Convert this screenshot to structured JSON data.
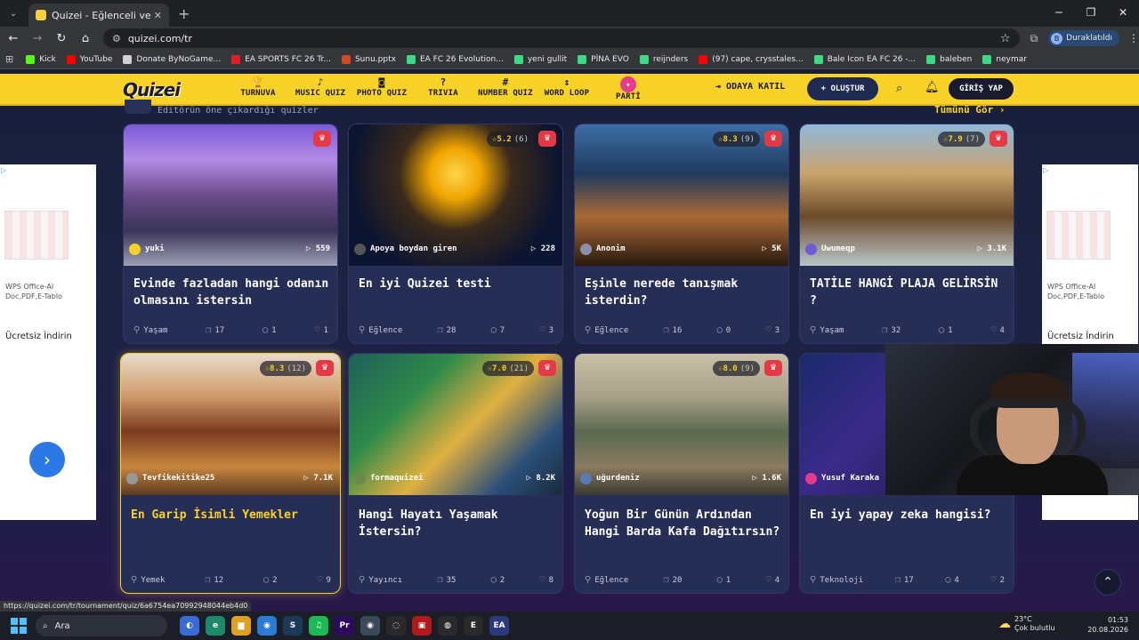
{
  "browser": {
    "tab_title": "Quizei - Eğlenceli ve etkileşimli",
    "url": "quizei.com/tr",
    "profile_initial": "B",
    "profile_label": "Duraklatıldı",
    "status_url": "https://quizei.com/tr/tournament/quiz/6a6754ea70992948044eb4d0",
    "bookmarks": [
      {
        "label": "Kick",
        "color": "#53fc18"
      },
      {
        "label": "YouTube",
        "color": "#ff0000"
      },
      {
        "label": "Donate ByNoGame...",
        "color": "#d0d0d0"
      },
      {
        "label": "EA SPORTS FC 26 Tr...",
        "color": "#e02020"
      },
      {
        "label": "Sunu.pptx",
        "color": "#d24726"
      },
      {
        "label": "EA FC 26 Evolution...",
        "color": "#3ddc84"
      },
      {
        "label": "yeni gullit",
        "color": "#3ddc84"
      },
      {
        "label": "PİNA EVO",
        "color": "#3ddc84"
      },
      {
        "label": "reijnders",
        "color": "#3ddc84"
      },
      {
        "label": "(97) cape, crysstales...",
        "color": "#ff0000"
      },
      {
        "label": "Bale Icon EA FC 26 -...",
        "color": "#3ddc84"
      },
      {
        "label": "baleben",
        "color": "#3ddc84"
      },
      {
        "label": "neymar",
        "color": "#3ddc84"
      }
    ]
  },
  "site": {
    "logo": "Quizei",
    "nav": [
      {
        "label": "TURNUVA",
        "icon": "🏆"
      },
      {
        "label": "MUSIC QUIZ",
        "icon": "♪"
      },
      {
        "label": "PHOTO QUIZ",
        "icon": "◙"
      },
      {
        "label": "TRIVIA",
        "icon": "?"
      },
      {
        "label": "NUMBER QUIZ",
        "icon": "#"
      },
      {
        "label": "WORD LOOP",
        "icon": "↕"
      },
      {
        "label": "PARTİ",
        "icon": "✦"
      }
    ],
    "join_label": "ODAYA KATIL",
    "create_label": "OLUŞTUR",
    "login_label": "GİRİŞ YAP",
    "section_subtitle": "Editörün öne çıkardığı quizler",
    "see_all": "Tümünü Gör"
  },
  "cards": [
    {
      "title": "Evinde fazladan hangi odanın olmasını istersin",
      "author": "yuki",
      "plays": "559",
      "rating": "",
      "rating_count": "",
      "category": "Yaşam",
      "questions": "17",
      "comments": "1",
      "likes": "1",
      "img": "linear-gradient(180deg,#7a5ad6 0%,#b48be8 25%,#6a4b8a 50%,#3a3358 75%,#9da0b5 100%)",
      "avatar_color": "#f8d227"
    },
    {
      "title": "En iyi Quizei testi",
      "author": "Apoya boydan giren",
      "plays": "228",
      "rating": "5.2",
      "rating_count": "(6)",
      "category": "Eğlence",
      "questions": "28",
      "comments": "7",
      "likes": "3",
      "img": "radial-gradient(circle at 50% 35%,#ffd54a 0%,#f0a500 18%,#3a2a1a 40%,#0b1430 75%)",
      "avatar_color": "#555"
    },
    {
      "title": "Eşinle nerede tanışmak isterdin?",
      "author": "Anonim",
      "plays": "5K",
      "rating": "8.3",
      "rating_count": "(9)",
      "category": "Eğlence",
      "questions": "16",
      "comments": "0",
      "likes": "3",
      "img": "linear-gradient(180deg,#3d6ea8 0%,#203a5c 35%,#a86a35 65%,#2a1a10 100%)",
      "avatar_color": "#8a8fae"
    },
    {
      "title": "TATİLE HANGİ PLAJA GELİRSİN ?",
      "author": "Uwumeqp",
      "plays": "3.1K",
      "rating": "7.9",
      "rating_count": "(7)",
      "category": "Yaşam",
      "questions": "32",
      "comments": "1",
      "likes": "4",
      "img": "linear-gradient(180deg,#8fb8d8 0%,#c9a46a 35%,#6b4a2a 65%,#b9c6c8 100%)",
      "avatar_color": "#6b5bd6"
    },
    {
      "title": "En Garip İsimli Yemekler",
      "author": "Tevfikekitike25",
      "plays": "7.1K",
      "rating": "8.3",
      "rating_count": "(12)",
      "category": "Yemek",
      "questions": "12",
      "comments": "2",
      "likes": "9",
      "img": "linear-gradient(180deg,#e8dcc8 0%,#d09a6a 30%,#7a3a1e 55%,#c7873f 80%,#5a3a22 100%)",
      "avatar_color": "#999"
    },
    {
      "title": "Hangi Hayatı Yaşamak İstersin?",
      "author": "formaquizei",
      "plays": "8.2K",
      "rating": "7.0",
      "rating_count": "(21)",
      "category": "Yayıncı",
      "questions": "35",
      "comments": "2",
      "likes": "8",
      "img": "linear-gradient(135deg,#1f5f5a 0%,#2f8a4a 30%,#e0b040 55%,#2a4f7a 80%,#1a2a3a 100%)",
      "avatar_color": "#6a8a4a"
    },
    {
      "title": "Yoğun Bir Günün Ardından Hangi Barda Kafa Dağıtırsın?",
      "author": "uğurdeniz",
      "plays": "1.6K",
      "rating": "8.0",
      "rating_count": "(9)",
      "category": "Eğlence",
      "questions": "20",
      "comments": "1",
      "likes": "4",
      "img": "linear-gradient(180deg,#c9c0a8 0%,#a8a088 30%,#5a6a50 55%,#8a7a60 80%,#3a3a30 100%)",
      "avatar_color": "#5a7ab8"
    },
    {
      "title": "En iyi yapay zeka hangisi?",
      "author": "Yusuf Karaka",
      "plays": "",
      "rating": "",
      "rating_count": "",
      "category": "Teknoloji",
      "questions": "17",
      "comments": "4",
      "likes": "2",
      "img": "linear-gradient(135deg,#1a2a6a 0%,#3a2a8a 40%,#1a1a3a 100%)",
      "avatar_color": "#e63b8c"
    }
  ],
  "ads": {
    "left_text": "WPS Office-AI Doc,PDF,E-Tablo",
    "left_button": "Ücretsiz İndirin",
    "right_text": "WPS Office-AI Doc,PDF,E-Tablo",
    "right_button": "Ücretsiz İndirin"
  },
  "taskbar": {
    "search_label": "Ara",
    "weather_temp": "23°C",
    "weather_desc": "Çok bulutlu",
    "time": "01:53",
    "date": "20.08.2026",
    "apps": [
      {
        "name": "copilot",
        "color": "#3a6ad6",
        "glyph": "◐"
      },
      {
        "name": "edge",
        "color": "#1d8a6a",
        "glyph": "e"
      },
      {
        "name": "explorer",
        "color": "#e0a020",
        "glyph": "▆"
      },
      {
        "name": "chrome",
        "color": "#2a7ad6",
        "glyph": "◉"
      },
      {
        "name": "steam",
        "color": "#1a3a5a",
        "glyph": "S"
      },
      {
        "name": "spotify",
        "color": "#1db954",
        "glyph": "♫"
      },
      {
        "name": "premiere",
        "color": "#2a0a5a",
        "glyph": "Pr"
      },
      {
        "name": "chrome-active",
        "color": "#3a4a5a",
        "glyph": "◉"
      },
      {
        "name": "app-round",
        "color": "#2a2a2a",
        "glyph": "◌"
      },
      {
        "name": "app-red",
        "color": "#b01a1a",
        "glyph": "▣"
      },
      {
        "name": "obs",
        "color": "#2a2a2a",
        "glyph": "◍"
      },
      {
        "name": "epic",
        "color": "#2a2a2a",
        "glyph": "E"
      },
      {
        "name": "ea",
        "color": "#2a3a7a",
        "glyph": "EA"
      }
    ]
  }
}
